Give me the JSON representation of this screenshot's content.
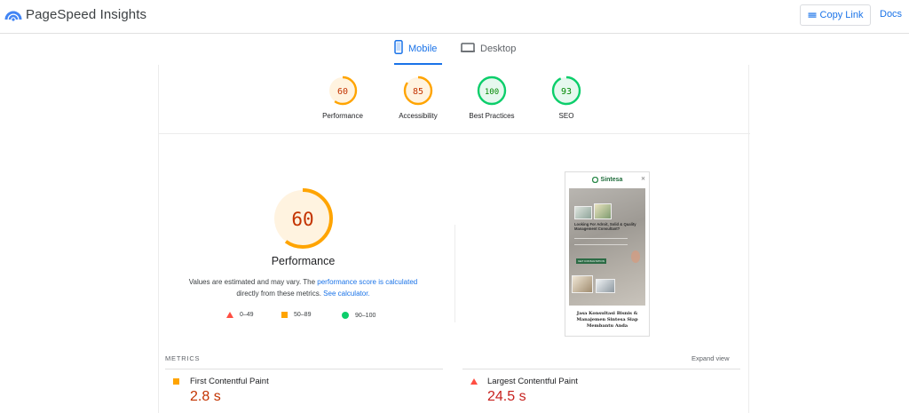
{
  "header": {
    "app_title": "PageSpeed Insights",
    "copy_link_label": "Copy Link",
    "docs_label": "Docs"
  },
  "tabs": [
    {
      "label": "Mobile",
      "active": true
    },
    {
      "label": "Desktop",
      "active": false
    }
  ],
  "colors": {
    "accent": "#1a73e8",
    "score_average": "#ffa400",
    "score_good": "#0cce6b",
    "score_poor": "#ff4e42",
    "text_average": "#c33300",
    "text_good": "#008800"
  },
  "scores": [
    {
      "label": "Performance",
      "value": 60,
      "status": "average"
    },
    {
      "label": "Accessibility",
      "value": 85,
      "status": "average"
    },
    {
      "label": "Best Practices",
      "value": 100,
      "status": "good"
    },
    {
      "label": "SEO",
      "value": 93,
      "status": "good"
    }
  ],
  "performance": {
    "score": 60,
    "title": "Performance",
    "desc_part1": "Values are estimated and may vary. The ",
    "desc_link1": "performance score is calculated",
    "desc_part2": " directly from these metrics. ",
    "desc_link2": "See calculator."
  },
  "legend": [
    {
      "range": "0–49",
      "icon": "triangle-icon"
    },
    {
      "range": "50–89",
      "icon": "square-icon"
    },
    {
      "range": "90–100",
      "icon": "circle-icon"
    }
  ],
  "screenshot": {
    "brand": "Sintesa",
    "headline": "Looking For Adroit, Solid & Quality Management Consultant?",
    "button": "GET CONSULTATION",
    "footer": "Jasa Konsultasi Bisnis & Manajemen Sintesa Siap Membantu Anda"
  },
  "metrics": {
    "section_label": "METRICS",
    "expand_label": "Expand view",
    "items": [
      {
        "name": "First Contentful Paint",
        "value": "2.8 s",
        "status": "average"
      },
      {
        "name": "Largest Contentful Paint",
        "value": "24.5 s",
        "status": "poor"
      }
    ]
  }
}
